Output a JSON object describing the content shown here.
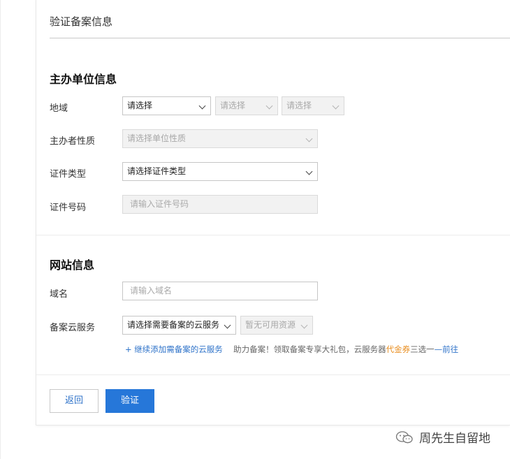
{
  "page": {
    "title": "验证备案信息"
  },
  "sponsor_section": {
    "title": "主办单位信息",
    "region": {
      "label": "地域",
      "province": "请选择",
      "city": "请选择",
      "district": "请选择"
    },
    "nature": {
      "label": "主办者性质",
      "value": "请选择单位性质"
    },
    "cert_type": {
      "label": "证件类型",
      "value": "请选择证件类型"
    },
    "cert_number": {
      "label": "证件号码",
      "placeholder": "请输入证件号码"
    }
  },
  "website_section": {
    "title": "网站信息",
    "domain": {
      "label": "域名",
      "placeholder": "请输入域名"
    },
    "cloud_service": {
      "label": "备案云服务",
      "service_select": "请选择需要备案的云服务",
      "resource_select": "暂无可用资源"
    },
    "hint": {
      "add_link": "+ 继续添加需备案的云服务",
      "promo_prefix": "助力备案！领取备案专享大礼包，云服务器",
      "promo_highlight": "代金券",
      "promo_suffix": "三选一",
      "promo_link": "前往"
    }
  },
  "actions": {
    "back": "返回",
    "verify": "验证"
  },
  "watermark": {
    "text": "周先生自留地",
    "icon": "wechat-official-account-icon"
  },
  "colors": {
    "primary": "#2677d9",
    "link": "#2f73c9",
    "highlight": "#e88c1c"
  }
}
